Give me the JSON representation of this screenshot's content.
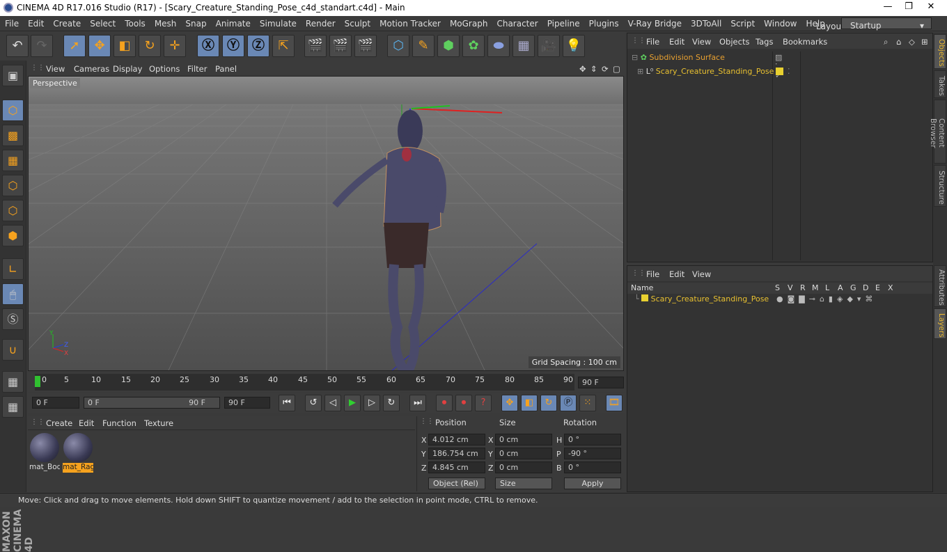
{
  "title": "CINEMA 4D R17.016 Studio (R17) - [Scary_Creature_Standing_Pose_c4d_standart.c4d] - Main",
  "menu": [
    "File",
    "Edit",
    "Create",
    "Select",
    "Tools",
    "Mesh",
    "Snap",
    "Animate",
    "Simulate",
    "Render",
    "Sculpt",
    "Motion Tracker",
    "MoGraph",
    "Character",
    "Pipeline",
    "Plugins",
    "V-Ray Bridge",
    "3DToAll",
    "Script",
    "Window",
    "Help"
  ],
  "layout": {
    "label": "Layout:",
    "value": "Startup"
  },
  "viewport": {
    "menu": [
      "View",
      "Cameras",
      "Display",
      "Options",
      "Filter",
      "Panel"
    ],
    "label": "Perspective",
    "grid": "Grid Spacing : 100 cm"
  },
  "timeline": {
    "ticks": [
      "0",
      "5",
      "10",
      "15",
      "20",
      "25",
      "30",
      "35",
      "40",
      "45",
      "50",
      "55",
      "60",
      "65",
      "70",
      "75",
      "80",
      "85",
      "90"
    ],
    "current": "90 F"
  },
  "playbar": {
    "start": "0 F",
    "range_start": "0 F",
    "range_end": "90 F",
    "end": "90 F"
  },
  "materials": {
    "menu": [
      "Create",
      "Edit",
      "Function",
      "Texture"
    ],
    "items": [
      {
        "name": "mat_Bod"
      },
      {
        "name": "mat_Rag"
      }
    ]
  },
  "coords": {
    "headers": [
      "Position",
      "Size",
      "Rotation"
    ],
    "position": {
      "x": "4.012 cm",
      "y": "186.754 cm",
      "z": "4.845 cm"
    },
    "size": {
      "x": "0 cm",
      "y": "0 cm",
      "z": "0 cm"
    },
    "rotation": {
      "h": "0 °",
      "p": "-90 °",
      "b": "0 °"
    },
    "labels": {
      "x": "X",
      "y": "Y",
      "z": "Z",
      "h": "H",
      "p": "P",
      "b": "B"
    },
    "mode": "Object (Rel)",
    "sizemode": "Size",
    "apply": "Apply"
  },
  "objects": {
    "menu": [
      "File",
      "Edit",
      "View",
      "Objects",
      "Tags",
      "Bookmarks"
    ],
    "items": [
      {
        "name": "Subdivision Surface"
      },
      {
        "name": "Scary_Creature_Standing_Pose"
      }
    ]
  },
  "layers": {
    "menu": [
      "File",
      "Edit",
      "View"
    ],
    "header": "Name",
    "cols": [
      "S",
      "V",
      "R",
      "M",
      "L",
      "A",
      "G",
      "D",
      "E",
      "X"
    ],
    "item": "Scary_Creature_Standing_Pose"
  },
  "sidetabs": [
    "Objects",
    "Takes",
    "Content Browser",
    "Structure",
    "Attributes",
    "Layers"
  ],
  "status": "Move: Click and drag to move elements. Hold down SHIFT to quantize movement / add to the selection in point mode, CTRL to remove.",
  "brand": "MAXON CINEMA 4D"
}
